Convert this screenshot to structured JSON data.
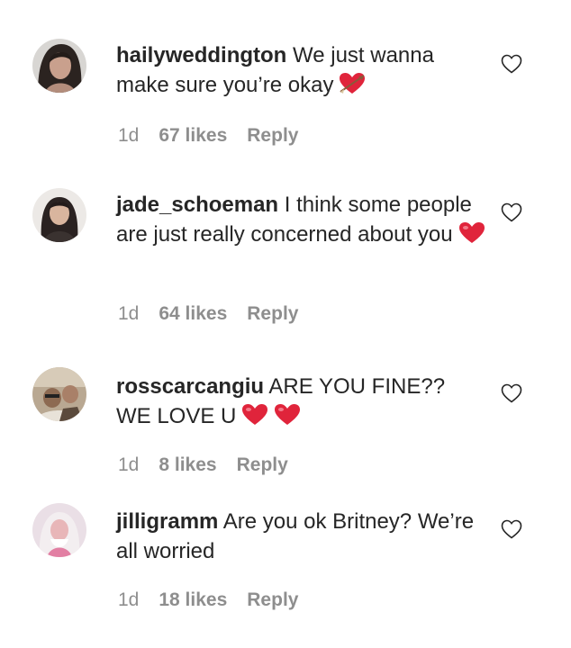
{
  "comments": [
    {
      "username": "hailyweddington",
      "text": "We just wanna make sure you’re okay",
      "emojis": [
        "arrow-heart-emoji"
      ],
      "age": "1d",
      "likes": "67 likes",
      "reply": "Reply"
    },
    {
      "username": "jade_schoeman",
      "text": "I think some people are just really concerned about you",
      "emojis": [
        "red-heart-emoji"
      ],
      "age": "1d",
      "likes": "64 likes",
      "reply": "Reply"
    },
    {
      "username": "rosscarcangiu",
      "text": "ARE YOU FINE?? WE LOVE U",
      "emojis": [
        "red-heart-emoji",
        "red-heart-emoji"
      ],
      "age": "1d",
      "likes": "8 likes",
      "reply": "Reply"
    },
    {
      "username": "jilligramm",
      "text": "Are you ok Britney? We’re all worried",
      "emojis": [],
      "age": "1d",
      "likes": "18 likes",
      "reply": "Reply"
    }
  ],
  "colors": {
    "text": "#262626",
    "meta": "#8e8e8e",
    "heart": "#e0243b"
  },
  "icons": {
    "like": "heart-outline-icon"
  }
}
